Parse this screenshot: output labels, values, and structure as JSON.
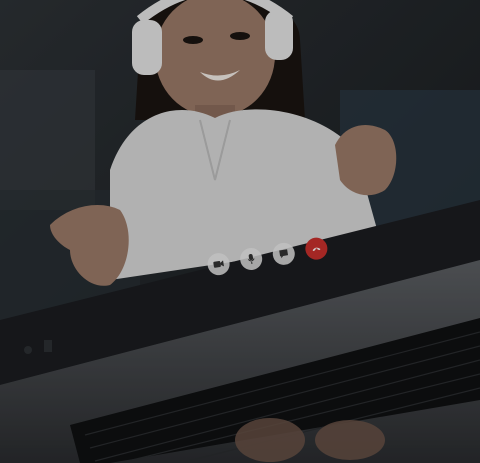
{
  "scene": {
    "subject": "",
    "palette": {
      "background": "#22262a",
      "shirt": "#d8d8d8",
      "skin": "#9c7a68",
      "hair": "#1a1410",
      "headphones": "#e6e6e6",
      "laptop_frame": "#1b1d20",
      "keyboard": "#0f1012",
      "end_call": "#c9302c"
    }
  },
  "call_controls": [
    {
      "icon": "video-camera-icon"
    },
    {
      "icon": "microphone-icon"
    },
    {
      "icon": "chat-bubble-icon"
    },
    {
      "icon": "end-call-icon"
    }
  ]
}
